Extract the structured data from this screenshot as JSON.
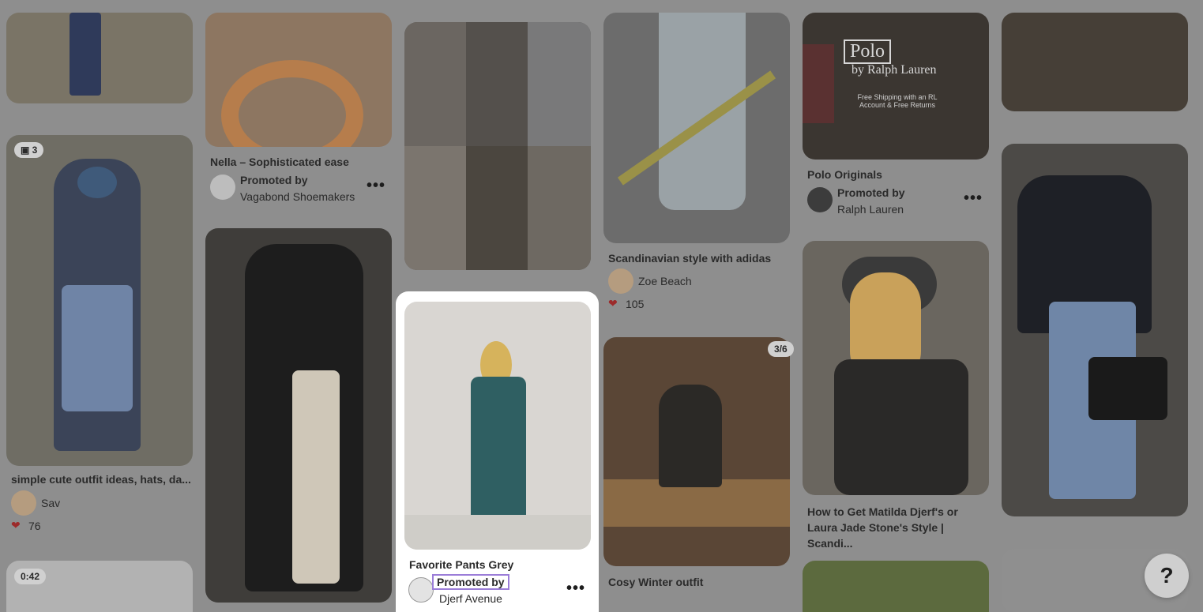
{
  "colors": {
    "page_bg": "#8e8e8e",
    "highlight_bg": "#ffffff",
    "promo_outline": "#9b7dd8"
  },
  "columns": [
    {
      "pins": [
        {
          "title": "",
          "image": "street outfit legs",
          "bg": "#7a7466"
        },
        {
          "title": "simple cute outfit ideas, hats, da...",
          "author": "Sav",
          "likes": "76",
          "badge": "3",
          "badge_icon": "board-icon",
          "bg": "#6f6d64"
        },
        {
          "title": "",
          "badge": "0:42",
          "bg": "#b2b2b2"
        }
      ]
    },
    {
      "pins": [
        {
          "title": "Nella – Sophisticated ease",
          "promoted_label": "Promoted by",
          "advertiser": "Vagabond Shoemakers",
          "bg": "#8d7661"
        },
        {
          "title": "",
          "image": "black coat outfit",
          "bg": "#3f3d3a"
        }
      ]
    },
    {
      "pins": [
        {
          "title": "",
          "image": "collage of black outfits",
          "bg": "#5e5b57"
        },
        {
          "title": "Favorite Pants Grey",
          "promoted_label": "Promoted by",
          "advertiser": "Djerf Avenue",
          "bg": "#d9d6d2"
        }
      ]
    },
    {
      "pins": [
        {
          "title": "Scandinavian style with adidas",
          "author": "Zoe Beach",
          "likes": "105",
          "bg": "#6c6c6c"
        },
        {
          "title": "Cosy Winter outfit",
          "badge": "3/6",
          "bg": "#5a4636"
        }
      ]
    },
    {
      "pins": [
        {
          "title": "Polo Originals",
          "promoted_label": "Promoted by",
          "advertiser": "Ralph Lauren",
          "brand": "Polo",
          "brand_sub": "by Ralph Lauren",
          "brand_note": "Free Shipping with an RL Account & Free Returns",
          "bg": "#3b3631"
        },
        {
          "title": "How to Get Matilda Djerf's or Laura Jade Stone's Style | Scandi...",
          "bg": "#6a665f"
        },
        {
          "title": "",
          "bg": "#5c6a3e"
        }
      ]
    },
    {
      "pins": [
        {
          "title": "",
          "bg": "#463f37"
        },
        {
          "title": "",
          "bg": "#4c4a47"
        },
        {
          "title": "",
          "bg": "#8f8f8f"
        }
      ]
    }
  ],
  "help": {
    "label": "?"
  }
}
